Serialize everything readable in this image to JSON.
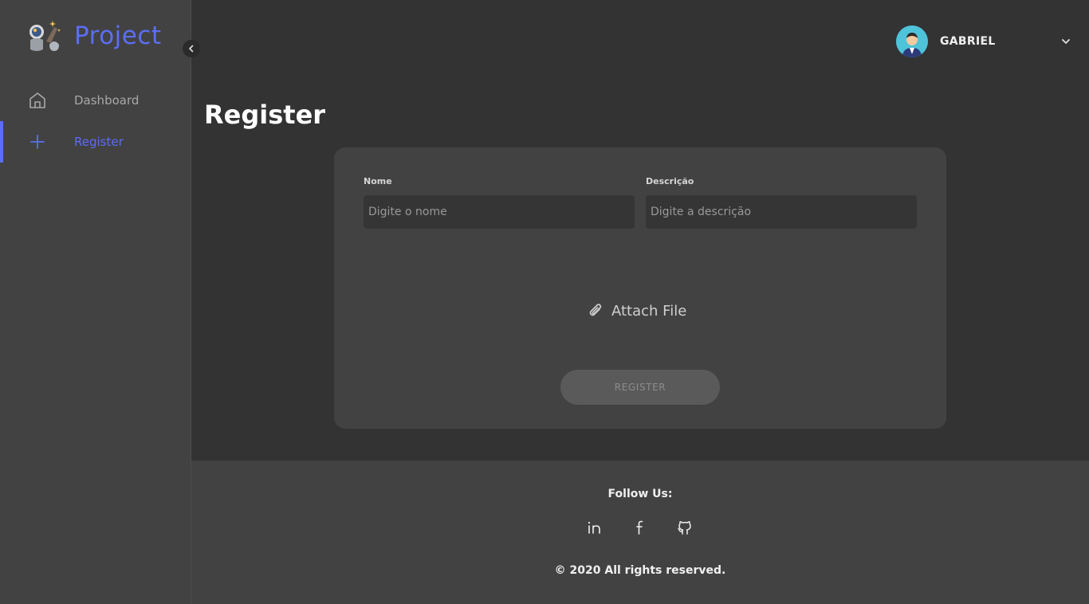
{
  "brand": {
    "name": "Project",
    "accent": "#5b6ef5"
  },
  "sidebar": {
    "items": [
      {
        "label": "Dashboard",
        "icon": "home-icon",
        "active": false
      },
      {
        "label": "Register",
        "icon": "plus-icon",
        "active": true
      }
    ],
    "collapse_icon": "chevron-left-icon"
  },
  "header": {
    "username": "GABRIEL",
    "avatar_icon": "avatar",
    "menu_icon": "chevron-down-icon"
  },
  "page": {
    "title": "Register"
  },
  "form": {
    "name_label": "Nome",
    "name_placeholder": "Digite o nome",
    "name_value": "",
    "description_label": "Descrição",
    "description_placeholder": "Digite a descrição",
    "description_value": "",
    "attach_label": "Attach File",
    "submit_label": "REGISTER"
  },
  "footer": {
    "follow_label": "Follow Us:",
    "socials": [
      "linkedin-icon",
      "facebook-icon",
      "github-icon"
    ],
    "copyright": "© 2020 All rights reserved."
  }
}
